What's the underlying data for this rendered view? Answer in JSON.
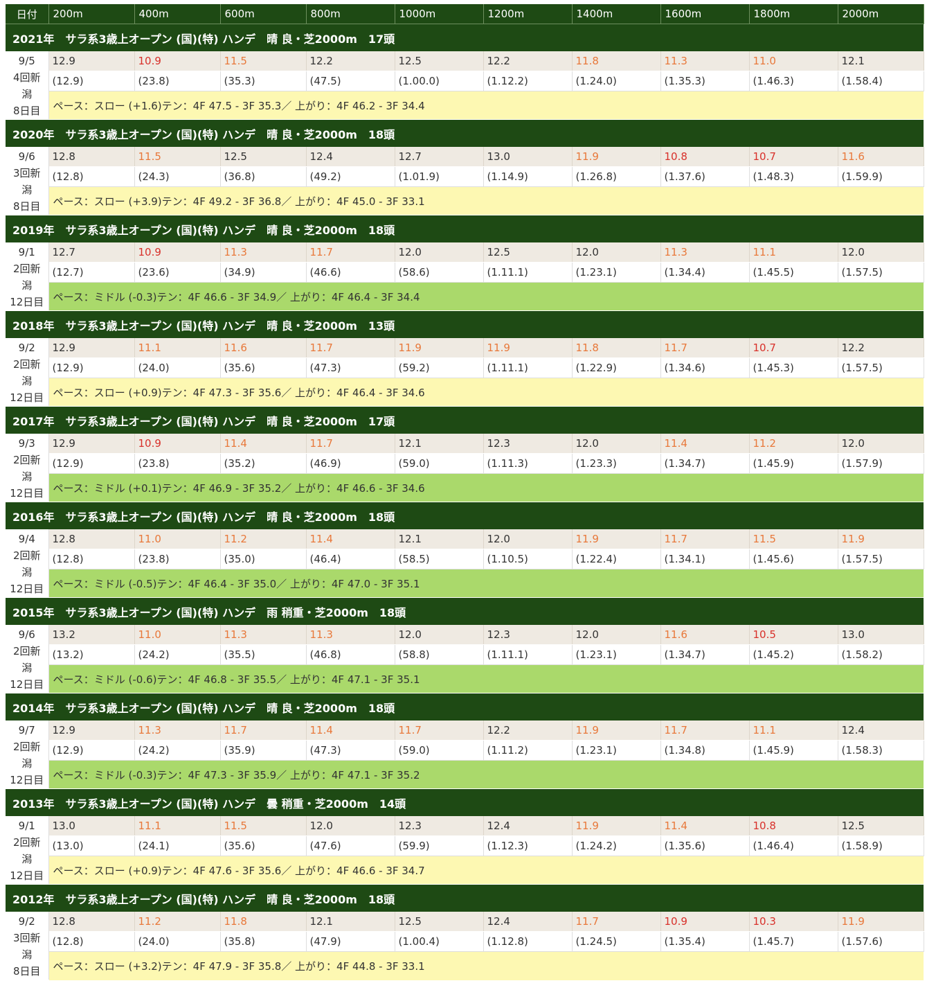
{
  "header": {
    "date_label": "日付",
    "distances": [
      "200m",
      "400m",
      "600m",
      "800m",
      "1000m",
      "1200m",
      "1400m",
      "1600m",
      "1800m",
      "2000m"
    ]
  },
  "races": [
    {
      "title": "2021年　サラ系3歳上オープン (国)(特) ハンデ　晴 良・芝2000m　17頭",
      "date": [
        "9/5",
        "4回新",
        "潟",
        "8日目"
      ],
      "laps": [
        "12.9",
        "10.9",
        "11.5",
        "12.2",
        "12.5",
        "12.2",
        "11.8",
        "11.3",
        "11.0",
        "12.1"
      ],
      "lap_colors": [
        "",
        "v",
        "f",
        "",
        "",
        "",
        "f",
        "f",
        "f",
        ""
      ],
      "cumulative": [
        "(12.9)",
        "(23.8)",
        "(35.3)",
        "(47.5)",
        "(1.00.0)",
        "(1.12.2)",
        "(1.24.0)",
        "(1.35.3)",
        "(1.46.3)",
        "(1.58.4)"
      ],
      "pace": "ペース：スロー (+1.6)テン：4F 47.5 - 3F 35.3／ 上がり：4F 46.2 - 3F 34.4",
      "pace_type": "slow"
    },
    {
      "title": "2020年　サラ系3歳上オープン (国)(特) ハンデ　晴 良・芝2000m　18頭",
      "date": [
        "9/6",
        "3回新",
        "潟",
        "8日目"
      ],
      "laps": [
        "12.8",
        "11.5",
        "12.5",
        "12.4",
        "12.7",
        "13.0",
        "11.9",
        "10.8",
        "10.7",
        "11.6"
      ],
      "lap_colors": [
        "",
        "f",
        "",
        "",
        "",
        "",
        "f",
        "v",
        "v",
        "f"
      ],
      "cumulative": [
        "(12.8)",
        "(24.3)",
        "(36.8)",
        "(49.2)",
        "(1.01.9)",
        "(1.14.9)",
        "(1.26.8)",
        "(1.37.6)",
        "(1.48.3)",
        "(1.59.9)"
      ],
      "pace": "ペース：スロー (+3.9)テン：4F 49.2 - 3F 36.8／ 上がり：4F 45.0 - 3F 33.1",
      "pace_type": "slow"
    },
    {
      "title": "2019年　サラ系3歳上オープン (国)(特) ハンデ　晴 良・芝2000m　18頭",
      "date": [
        "9/1",
        "2回新",
        "潟",
        "12日目"
      ],
      "laps": [
        "12.7",
        "10.9",
        "11.3",
        "11.7",
        "12.0",
        "12.5",
        "12.0",
        "11.3",
        "11.1",
        "12.0"
      ],
      "lap_colors": [
        "",
        "v",
        "f",
        "f",
        "",
        "",
        "",
        "f",
        "f",
        ""
      ],
      "cumulative": [
        "(12.7)",
        "(23.6)",
        "(34.9)",
        "(46.6)",
        "(58.6)",
        "(1.11.1)",
        "(1.23.1)",
        "(1.34.4)",
        "(1.45.5)",
        "(1.57.5)"
      ],
      "pace": "ペース：ミドル (-0.3)テン：4F 46.6 - 3F 34.9／ 上がり：4F 46.4 - 3F 34.4",
      "pace_type": "mid"
    },
    {
      "title": "2018年　サラ系3歳上オープン (国)(特) ハンデ　晴 良・芝2000m　13頭",
      "date": [
        "9/2",
        "2回新",
        "潟",
        "12日目"
      ],
      "laps": [
        "12.9",
        "11.1",
        "11.6",
        "11.7",
        "11.9",
        "11.9",
        "11.8",
        "11.7",
        "10.7",
        "12.2"
      ],
      "lap_colors": [
        "",
        "f",
        "f",
        "f",
        "f",
        "f",
        "f",
        "f",
        "v",
        ""
      ],
      "cumulative": [
        "(12.9)",
        "(24.0)",
        "(35.6)",
        "(47.3)",
        "(59.2)",
        "(1.11.1)",
        "(1.22.9)",
        "(1.34.6)",
        "(1.45.3)",
        "(1.57.5)"
      ],
      "pace": "ペース：スロー (+0.9)テン：4F 47.3 - 3F 35.6／ 上がり：4F 46.4 - 3F 34.6",
      "pace_type": "slow"
    },
    {
      "title": "2017年　サラ系3歳上オープン (国)(特) ハンデ　晴 良・芝2000m　17頭",
      "date": [
        "9/3",
        "2回新",
        "潟",
        "12日目"
      ],
      "laps": [
        "12.9",
        "10.9",
        "11.4",
        "11.7",
        "12.1",
        "12.3",
        "12.0",
        "11.4",
        "11.2",
        "12.0"
      ],
      "lap_colors": [
        "",
        "v",
        "f",
        "f",
        "",
        "",
        "",
        "f",
        "f",
        ""
      ],
      "cumulative": [
        "(12.9)",
        "(23.8)",
        "(35.2)",
        "(46.9)",
        "(59.0)",
        "(1.11.3)",
        "(1.23.3)",
        "(1.34.7)",
        "(1.45.9)",
        "(1.57.9)"
      ],
      "pace": "ペース：ミドル (+0.1)テン：4F 46.9 - 3F 35.2／ 上がり：4F 46.6 - 3F 34.6",
      "pace_type": "mid"
    },
    {
      "title": "2016年　サラ系3歳上オープン (国)(特) ハンデ　晴 良・芝2000m　18頭",
      "date": [
        "9/4",
        "2回新",
        "潟",
        "12日目"
      ],
      "laps": [
        "12.8",
        "11.0",
        "11.2",
        "11.4",
        "12.1",
        "12.0",
        "11.9",
        "11.7",
        "11.5",
        "11.9"
      ],
      "lap_colors": [
        "",
        "f",
        "f",
        "f",
        "",
        "",
        "f",
        "f",
        "f",
        "f"
      ],
      "cumulative": [
        "(12.8)",
        "(23.8)",
        "(35.0)",
        "(46.4)",
        "(58.5)",
        "(1.10.5)",
        "(1.22.4)",
        "(1.34.1)",
        "(1.45.6)",
        "(1.57.5)"
      ],
      "pace": "ペース：ミドル (-0.5)テン：4F 46.4 - 3F 35.0／ 上がり：4F 47.0 - 3F 35.1",
      "pace_type": "mid"
    },
    {
      "title": "2015年　サラ系3歳上オープン (国)(特) ハンデ　雨 稍重・芝2000m　18頭",
      "date": [
        "9/6",
        "2回新",
        "潟",
        "12日目"
      ],
      "laps": [
        "13.2",
        "11.0",
        "11.3",
        "11.3",
        "12.0",
        "12.3",
        "12.0",
        "11.6",
        "10.5",
        "13.0"
      ],
      "lap_colors": [
        "",
        "f",
        "f",
        "f",
        "",
        "",
        "",
        "f",
        "v",
        ""
      ],
      "cumulative": [
        "(13.2)",
        "(24.2)",
        "(35.5)",
        "(46.8)",
        "(58.8)",
        "(1.11.1)",
        "(1.23.1)",
        "(1.34.7)",
        "(1.45.2)",
        "(1.58.2)"
      ],
      "pace": "ペース：ミドル (-0.6)テン：4F 46.8 - 3F 35.5／ 上がり：4F 47.1 - 3F 35.1",
      "pace_type": "mid"
    },
    {
      "title": "2014年　サラ系3歳上オープン (国)(特) ハンデ　晴 良・芝2000m　18頭",
      "date": [
        "9/7",
        "2回新",
        "潟",
        "12日目"
      ],
      "laps": [
        "12.9",
        "11.3",
        "11.7",
        "11.4",
        "11.7",
        "12.2",
        "11.9",
        "11.7",
        "11.1",
        "12.4"
      ],
      "lap_colors": [
        "",
        "f",
        "f",
        "f",
        "f",
        "",
        "f",
        "f",
        "f",
        ""
      ],
      "cumulative": [
        "(12.9)",
        "(24.2)",
        "(35.9)",
        "(47.3)",
        "(59.0)",
        "(1.11.2)",
        "(1.23.1)",
        "(1.34.8)",
        "(1.45.9)",
        "(1.58.3)"
      ],
      "pace": "ペース：ミドル (-0.3)テン：4F 47.3 - 3F 35.9／ 上がり：4F 47.1 - 3F 35.2",
      "pace_type": "mid"
    },
    {
      "title": "2013年　サラ系3歳上オープン (国)(特) ハンデ　曇 稍重・芝2000m　14頭",
      "date": [
        "9/1",
        "2回新",
        "潟",
        "12日目"
      ],
      "laps": [
        "13.0",
        "11.1",
        "11.5",
        "12.0",
        "12.3",
        "12.4",
        "11.9",
        "11.4",
        "10.8",
        "12.5"
      ],
      "lap_colors": [
        "",
        "f",
        "f",
        "",
        "",
        "",
        "f",
        "f",
        "v",
        ""
      ],
      "cumulative": [
        "(13.0)",
        "(24.1)",
        "(35.6)",
        "(47.6)",
        "(59.9)",
        "(1.12.3)",
        "(1.24.2)",
        "(1.35.6)",
        "(1.46.4)",
        "(1.58.9)"
      ],
      "pace": "ペース：スロー (+0.9)テン：4F 47.6 - 3F 35.6／ 上がり：4F 46.6 - 3F 34.7",
      "pace_type": "slow"
    },
    {
      "title": "2012年　サラ系3歳上オープン (国)(特) ハンデ　晴 良・芝2000m　18頭",
      "date": [
        "9/2",
        "3回新",
        "潟",
        "8日目"
      ],
      "laps": [
        "12.8",
        "11.2",
        "11.8",
        "12.1",
        "12.5",
        "12.4",
        "11.7",
        "10.9",
        "10.3",
        "11.9"
      ],
      "lap_colors": [
        "",
        "f",
        "f",
        "",
        "",
        "",
        "f",
        "v",
        "v",
        "f"
      ],
      "cumulative": [
        "(12.8)",
        "(24.0)",
        "(35.8)",
        "(47.9)",
        "(1.00.4)",
        "(1.12.8)",
        "(1.24.5)",
        "(1.35.4)",
        "(1.45.7)",
        "(1.57.6)"
      ],
      "pace": "ペース：スロー (+3.2)テン：4F 47.9 - 3F 35.8／ 上がり：4F 44.8 - 3F 33.1",
      "pace_type": "slow"
    }
  ]
}
